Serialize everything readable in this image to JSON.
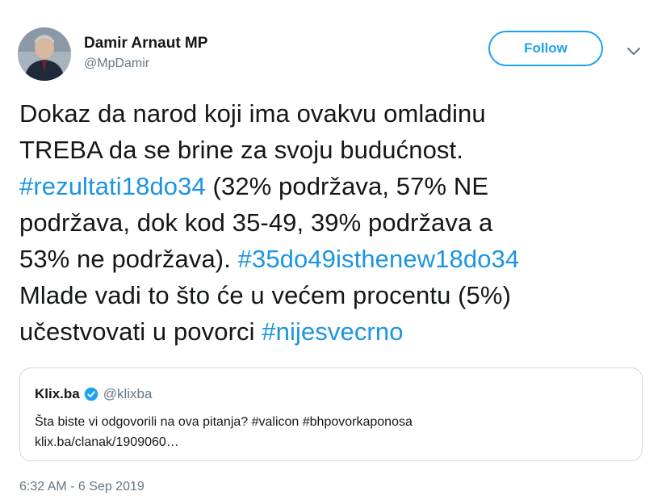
{
  "author": {
    "display_name": "Damir Arnaut MP",
    "handle": "@MpDamir",
    "avatar_icon": "person-avatar"
  },
  "follow_button": {
    "label": "Follow"
  },
  "menu_icon": "chevron-down-icon",
  "tweet": {
    "lines": [
      [
        {
          "text": "Dokaz da narod koji ima ovakvu omladinu",
          "tag": false
        }
      ],
      [
        {
          "text": "TREBA da se brine za svoju budućnost.",
          "tag": false
        }
      ],
      [
        {
          "text": "#rezultati18do34",
          "tag": true
        },
        {
          "text": " (32% podržava, 57% NE",
          "tag": false
        }
      ],
      [
        {
          "text": "podržava, dok kod 35-49, 39% podržava a",
          "tag": false
        }
      ],
      [
        {
          "text": "53% ne podržava). ",
          "tag": false
        },
        {
          "text": "#35do49isthenew18do34",
          "tag": true
        }
      ],
      [
        {
          "text": "Mlade vadi to što će u većem procentu (5%)",
          "tag": false
        }
      ],
      [
        {
          "text": "učestvovati u povorci ",
          "tag": false
        },
        {
          "text": "#nijesvecrno",
          "tag": true
        }
      ]
    ]
  },
  "quote": {
    "name": "Klix.ba",
    "handle": "@klixba",
    "text": "Šta biste vi odgovorili na ova pitanja? #valicon #bhpovorkaponosa",
    "link": "klix.ba/clanak/1909060…"
  },
  "timestamp": "6:32 AM - 6 Sep 2019",
  "colors": {
    "accent": "#1da1f2",
    "hashtag": "#1b95e0",
    "secondary_text": "#657786",
    "border": "#ccd6dd"
  }
}
